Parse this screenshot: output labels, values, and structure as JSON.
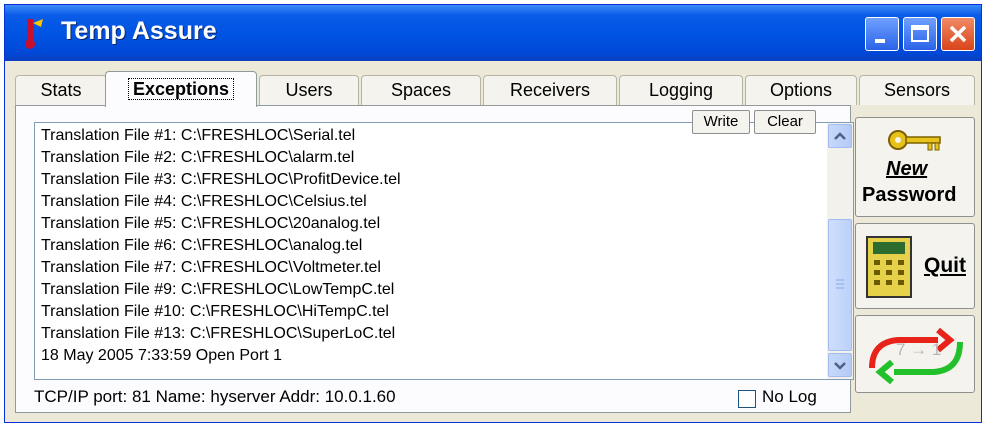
{
  "window": {
    "title": "Temp Assure",
    "accent": "#0054e3"
  },
  "tabs": [
    {
      "label": "Stats"
    },
    {
      "label": "Exceptions"
    },
    {
      "label": "Users"
    },
    {
      "label": "Spaces"
    },
    {
      "label": "Receivers"
    },
    {
      "label": "Logging"
    },
    {
      "label": "Options"
    },
    {
      "label": "Sensors"
    }
  ],
  "active_tab": "Exceptions",
  "list": {
    "write_label": "Write",
    "clear_label": "Clear",
    "lines": [
      "Translation File #1: C:\\FRESHLOC\\Serial.tel",
      "Translation File #2: C:\\FRESHLOC\\alarm.tel",
      "Translation File #3: C:\\FRESHLOC\\ProfitDevice.tel",
      "Translation File #4: C:\\FRESHLOC\\Celsius.tel",
      "Translation File #5: C:\\FRESHLOC\\20analog.tel",
      "Translation File #6: C:\\FRESHLOC\\analog.tel",
      "Translation File #7: C:\\FRESHLOC\\Voltmeter.tel",
      "Translation File #9: C:\\FRESHLOC\\LowTempC.tel",
      "Translation File #10: C:\\FRESHLOC\\HiTempC.tel",
      "Translation File #13: C:\\FRESHLOC\\SuperLoC.tel",
      "18 May 2005 7:33:59 Open Port 1"
    ]
  },
  "status": {
    "text": "TCP/IP port: 81 Name: hyserver Addr: 10.0.1.60",
    "no_log_label": "No Log",
    "no_log_checked": false
  },
  "buttons": {
    "new_password_line1": "New",
    "new_password_line2": "Password",
    "quit_label": "Quit",
    "sync_label": "7 → 1"
  }
}
